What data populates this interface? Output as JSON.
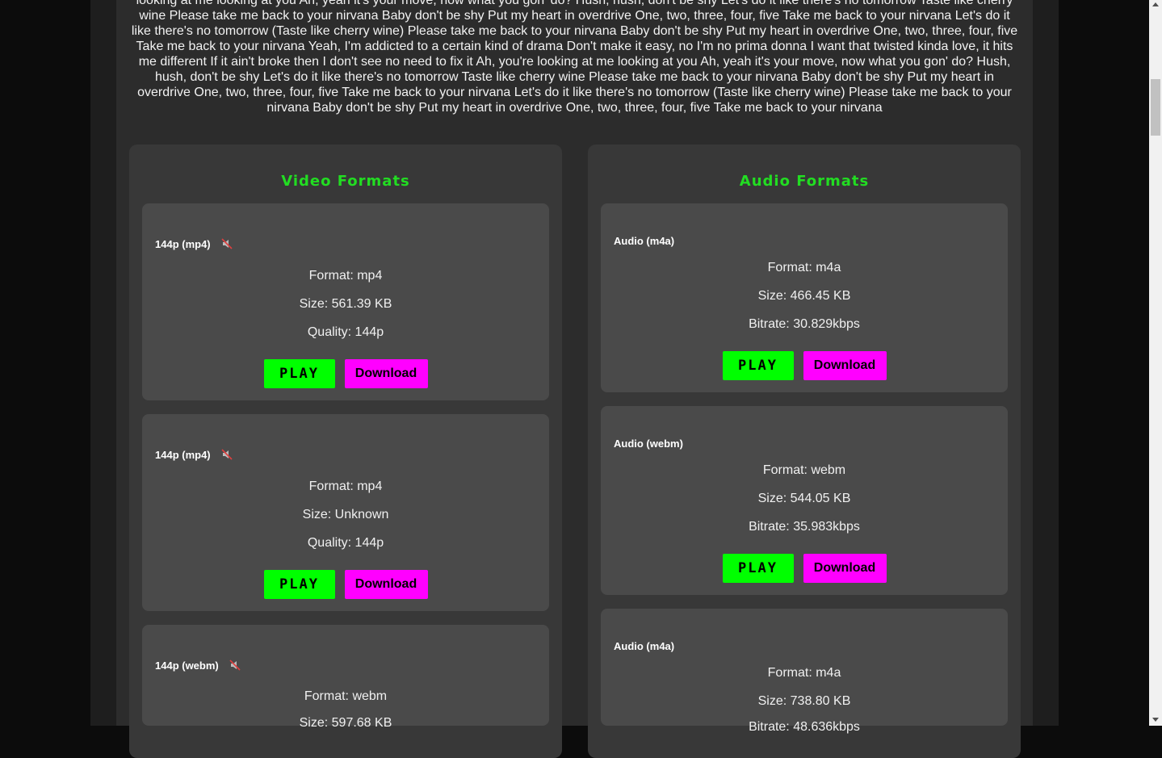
{
  "lyrics": "looking at me looking at you Ah, yeah it's your move, now what you gon' do? Hush, hush, don't be shy Let's do it like there's no tomorrow Taste like cherry wine Please take me back to your nirvana Baby don't be shy Put my heart in overdrive One, two, three, four, five Take me back to your nirvana Let's do it like there's no tomorrow (Taste like cherry wine) Please take me back to your nirvana Baby don't be shy Put my heart in overdrive One, two, three, four, five Take me back to your nirvana Yeah, I'm addicted to a certain kind of drama Don't make it easy, no I'm no prima donna I want that twisted kinda love, it hits me different If it ain't broke then I don't see no need to fix it Ah, you're looking at me looking at you Ah, yeah it's your move, now what you gon' do? Hush, hush, don't be shy Let's do it like there's no tomorrow Taste like cherry wine Please take me back to your nirvana Baby don't be shy Put my heart in overdrive One, two, three, four, five Take me back to your nirvana Let's do it like there's no tomorrow (Taste like cherry wine) Please take me back to your nirvana Baby don't be shy Put my heart in overdrive One, two, three, four, five Take me back to your nirvana",
  "video": {
    "title": "Video Formats",
    "cards": [
      {
        "title": "144p (mp4)",
        "icon": "muted-speaker-icon",
        "format": "Format: mp4",
        "size": "Size: 561.39 KB",
        "quality": "Quality: 144p",
        "play": "PLAY",
        "download": "Download"
      },
      {
        "title": "144p (mp4)",
        "icon": "muted-speaker-icon",
        "format": "Format: mp4",
        "size": "Size: Unknown",
        "quality": "Quality: 144p",
        "play": "PLAY",
        "download": "Download"
      },
      {
        "title": "144p (webm)",
        "icon": "muted-speaker-icon",
        "format": "Format: webm",
        "size": "Size: 597.68 KB"
      }
    ]
  },
  "audio": {
    "title": "Audio Formats",
    "cards": [
      {
        "title": "Audio (m4a)",
        "format": "Format: m4a",
        "size": "Size: 466.45 KB",
        "bitrate": "Bitrate: 30.829kbps",
        "play": "PLAY",
        "download": "Download"
      },
      {
        "title": "Audio (webm)",
        "format": "Format: webm",
        "size": "Size: 544.05 KB",
        "bitrate": "Bitrate: 35.983kbps",
        "play": "PLAY",
        "download": "Download"
      },
      {
        "title": "Audio (m4a)",
        "format": "Format: m4a",
        "size": "Size: 738.80 KB",
        "bitrate": "Bitrate: 48.636kbps"
      }
    ]
  },
  "colors": {
    "accent_green": "#00ff00",
    "title_green": "#22dd22",
    "download_magenta": "#ff00ff",
    "card_bg": "#4a4a4a"
  }
}
